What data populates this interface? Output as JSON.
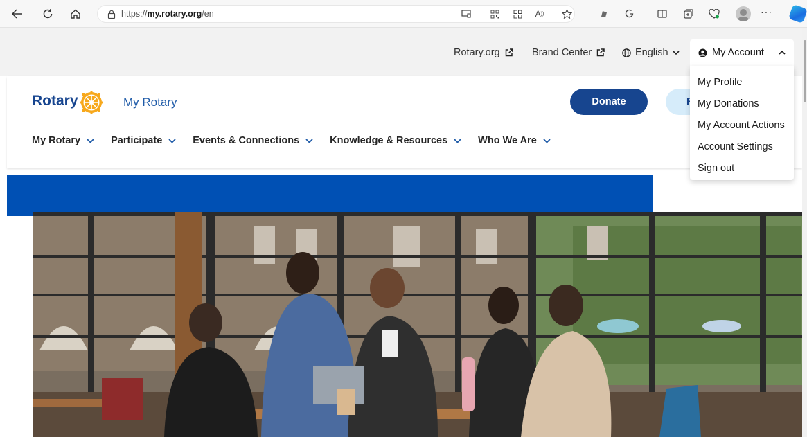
{
  "browser": {
    "url_prefix": "https://",
    "url_host": "my.rotary.org",
    "url_path": "/en",
    "read_aloud": "A",
    "more": "···"
  },
  "utility": {
    "rotary_org": "Rotary.org",
    "brand_center": "Brand Center",
    "language": "English",
    "account": "My Account"
  },
  "header": {
    "logo_text": "Rotary",
    "site_name": "My Rotary",
    "donate_label": "Donate",
    "secondary_label": "F"
  },
  "main_nav": [
    {
      "label": "My Rotary"
    },
    {
      "label": "Participate"
    },
    {
      "label": "Events & Connections"
    },
    {
      "label": "Knowledge & Resources"
    },
    {
      "label": "Who We Are"
    }
  ],
  "account_menu": [
    {
      "label": "My Profile"
    },
    {
      "label": "My Donations"
    },
    {
      "label": "My Account Actions"
    },
    {
      "label": "Account Settings"
    },
    {
      "label": "Sign out"
    }
  ],
  "colors": {
    "brand_blue": "#17458f",
    "hero_blue": "#0050b4",
    "gold": "#f7a81b"
  }
}
